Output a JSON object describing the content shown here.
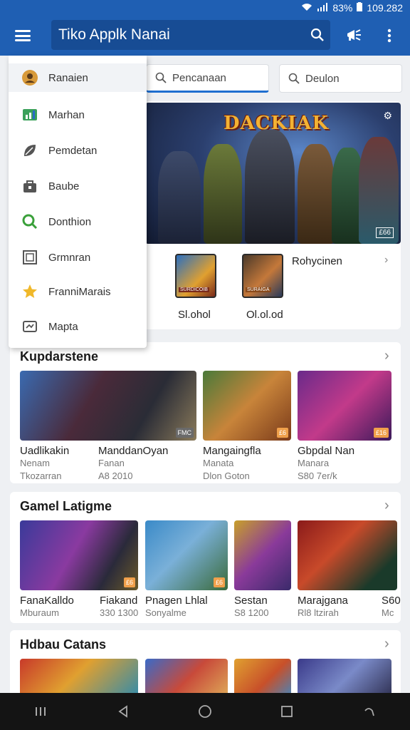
{
  "status": {
    "battery": "83%",
    "time": "109.282"
  },
  "appbar": {
    "title": "Tiko Applk Nanai"
  },
  "tabs": [
    {
      "label": "Pencanaan"
    },
    {
      "label": "Deulon"
    }
  ],
  "drawer": {
    "items": [
      {
        "label": "Ranaien",
        "icon": "profile-icon"
      },
      {
        "label": "Marhan",
        "icon": "chart-icon"
      },
      {
        "label": "Pemdetan",
        "icon": "leaf-icon"
      },
      {
        "label": "Baube",
        "icon": "bag-icon"
      },
      {
        "label": "Donthion",
        "icon": "search-circle-icon"
      },
      {
        "label": "Grmnran",
        "icon": "grid-icon"
      },
      {
        "label": "FranniMarais",
        "icon": "star-icon"
      },
      {
        "label": "Mapta",
        "icon": "map-icon"
      }
    ]
  },
  "featured": {
    "banner_title": "DACKIAK",
    "banner_badge": "£66",
    "tiles": [
      {
        "label": "Sl.ohol",
        "badge": "SURDICOIB"
      },
      {
        "label": "Ol.ol.od",
        "badge": "SURAIGA"
      }
    ],
    "side_label": "Rohycinen"
  },
  "sections": [
    {
      "title": "Kupdarstene",
      "cards": [
        {
          "title": "Uadlikakin",
          "sub1": "Nenam",
          "sub2": "Tkozarran"
        },
        {
          "title": "ManddanOyan",
          "sub1": "Fanan",
          "sub2": "A8 2010",
          "badge": "FMC"
        },
        {
          "title": "Mangaingfla",
          "sub1": "Manata",
          "sub2": "Dlon Goton",
          "badge": "£6"
        },
        {
          "title": "Gbpdal Nan",
          "sub1": "Manara",
          "sub2": "S80 7er/k",
          "badge": "£16"
        }
      ]
    },
    {
      "title": "Gamel Latigme",
      "cards": [
        {
          "title": "FanaKalldo",
          "sub1": "Mburaum",
          "sub2": "",
          "badge": "£6"
        },
        {
          "title": "Fiakand",
          "sub1": "330 1300",
          "sub2": ""
        },
        {
          "title": "Pnagen Lhlal",
          "sub1": "Sonyalme",
          "sub2": "",
          "badge": "£6"
        },
        {
          "title": "Sestan",
          "sub1": "S8 1200",
          "sub2": ""
        },
        {
          "title": "Marajgana",
          "sub1": "Rl8 ltzirah",
          "sub2": ""
        },
        {
          "title": "S60",
          "sub1": "Mc",
          "sub2": ""
        }
      ]
    },
    {
      "title": "Hdbau Catans",
      "cards": []
    }
  ],
  "colors": {
    "primary": "#1f5fb3",
    "accent": "#f0a04b"
  }
}
